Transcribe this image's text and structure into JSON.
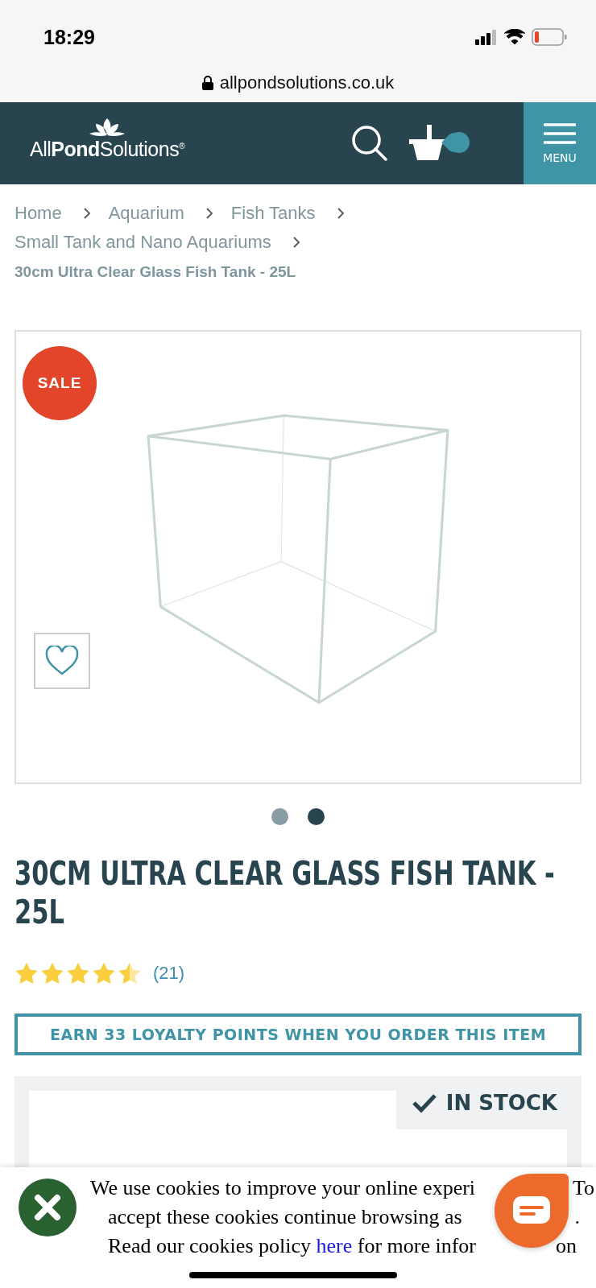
{
  "status_bar": {
    "time": "18:29",
    "url": "allpondsolutions.co.uk"
  },
  "header": {
    "logo": {
      "light": "All",
      "bold": "Pond",
      "light2": "Solutions",
      "mark": "®"
    },
    "menu_label": "MENU"
  },
  "breadcrumbs": [
    {
      "label": "Home",
      "current": false
    },
    {
      "label": "Aquarium",
      "current": false
    },
    {
      "label": "Fish Tanks",
      "current": false
    },
    {
      "label": "Small Tank and Nano Aquariums",
      "current": false
    },
    {
      "label": "30cm Ultra Clear Glass Fish Tank - 25L",
      "current": true
    }
  ],
  "product": {
    "badge": "SALE",
    "favorite": false,
    "gallery_dots": [
      {
        "selected": false
      },
      {
        "selected": true
      }
    ],
    "title": "30CM ULTRA CLEAR GLASS FISH TANK - 25L",
    "stars": 4.5,
    "review_count": "(21)",
    "loyalty": "EARN 33 LOYALTY POINTS WHEN YOU ORDER THIS ITEM",
    "stock": "IN STOCK"
  },
  "cookie_banner": {
    "lines": [
      [
        {
          "text": "We use cookies to improve your online experi"
        },
        {
          "text": "To"
        }
      ],
      [
        {
          "text": "accept these cookies continue browsing as"
        },
        {
          "text": "."
        }
      ],
      [
        {
          "text": "Read our cookies policy ",
          "link": "here",
          "after": " for more infor"
        },
        {
          "text": "on"
        }
      ]
    ]
  }
}
